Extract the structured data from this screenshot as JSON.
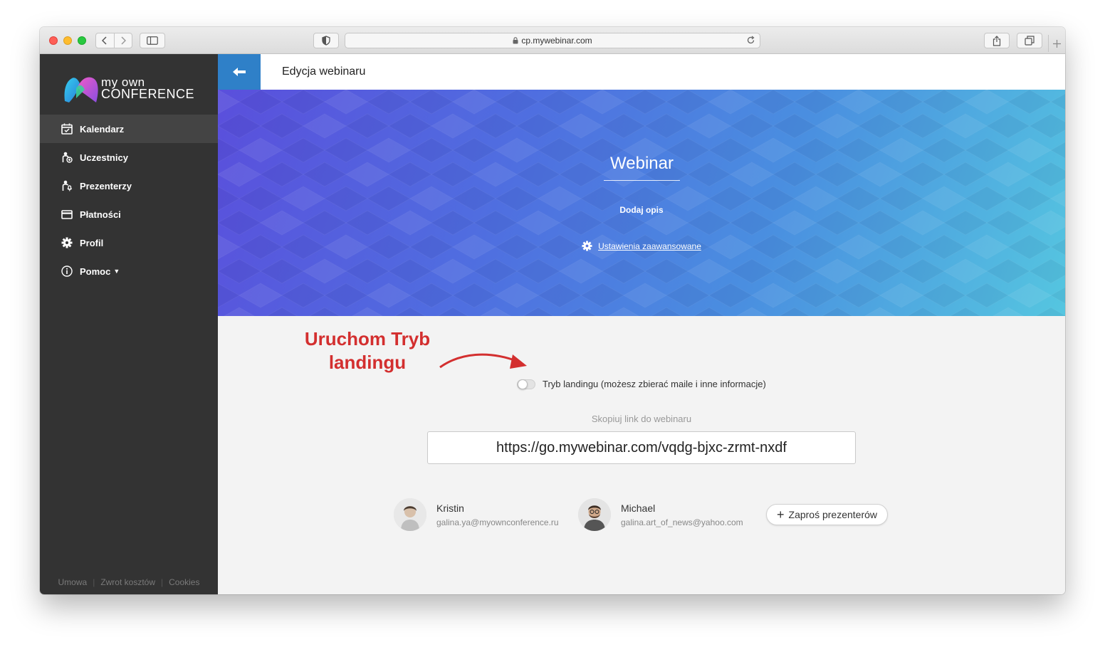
{
  "browser": {
    "url": "cp.mywebinar.com"
  },
  "brand": {
    "line1": "my own",
    "line2": "CONFERENCE"
  },
  "sidebar": {
    "items": [
      {
        "label": "Kalendarz",
        "icon": "calendar-icon",
        "active": true
      },
      {
        "label": "Uczestnicy",
        "icon": "participants-icon",
        "active": false
      },
      {
        "label": "Prezenterzy",
        "icon": "presenter-icon",
        "active": false
      },
      {
        "label": "Płatności",
        "icon": "card-icon",
        "active": false
      },
      {
        "label": "Profil",
        "icon": "gear-icon",
        "active": false
      },
      {
        "label": "Pomoc",
        "icon": "info-icon",
        "active": false
      }
    ],
    "footer": [
      "Umowa",
      "Zwrot kosztów",
      "Cookies"
    ]
  },
  "header": {
    "title": "Edycja webinaru"
  },
  "hero": {
    "title": "Webinar",
    "description": "Dodaj opis",
    "settings_link": "Ustawienia zaawansowane"
  },
  "annotation": {
    "line1": "Uruchom Tryb",
    "line2": "landingu",
    "color": "#d32f2f"
  },
  "landing": {
    "label": "Tryb landingu (możesz zbierać maile i inne informacje)",
    "enabled": false
  },
  "link": {
    "label": "Skopiuj link do webinaru",
    "url": "https://go.mywebinar.com/vqdg-bjxc-zrmt-nxdf"
  },
  "presenters": [
    {
      "name": "Kristin",
      "email": "galina.ya@myownconference.ru"
    },
    {
      "name": "Michael",
      "email": "galina.art_of_news@yahoo.com"
    }
  ],
  "invite_button": "Zaproś prezenterów",
  "colors": {
    "sidebar_bg": "#333333",
    "accent_blue": "#2f80c8"
  }
}
